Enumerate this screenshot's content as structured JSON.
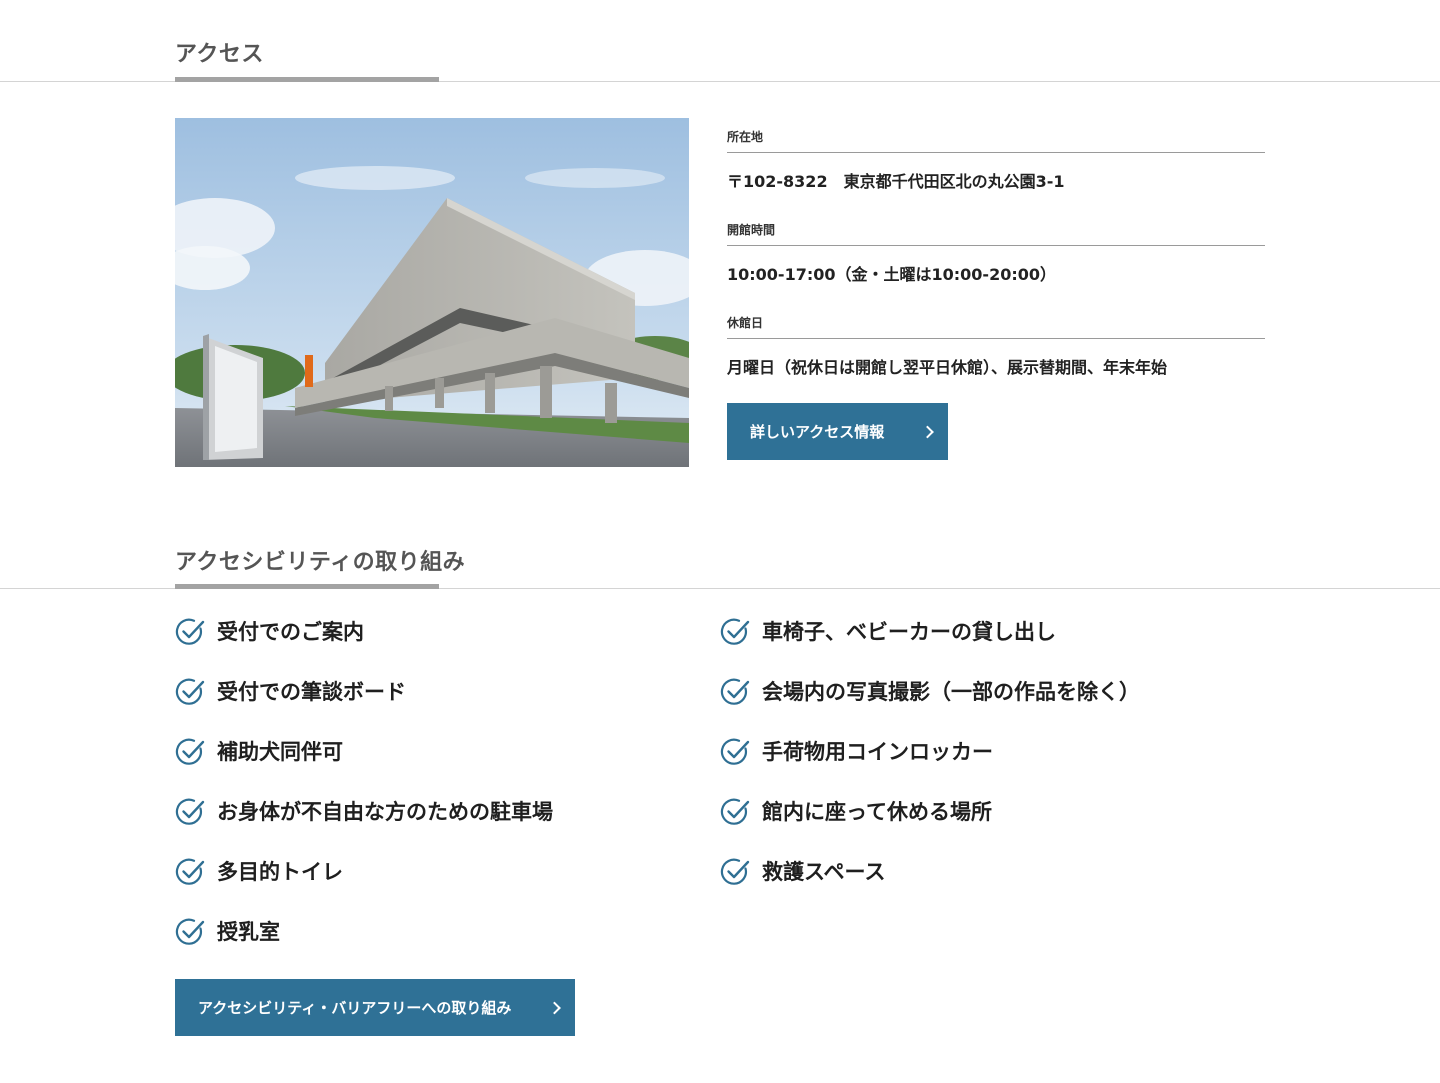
{
  "access": {
    "title": "アクセス",
    "photo": {
      "icon": "museum-building-photo"
    },
    "address_label": "所在地",
    "address_value": "〒102-8322　東京都千代田区北の丸公園3-1",
    "hours_label": "開館時間",
    "hours_value": "10:00-17:00（金・土曜は10:00-20:00）",
    "closed_label": "休館日",
    "closed_value": "月曜日（祝休日は開館し翌平日休館）、展示替期間、年末年始",
    "button_label": "詳しいアクセス情報"
  },
  "accessibility": {
    "title": "アクセシビリティの取り組み",
    "left_items": [
      "受付でのご案内",
      "受付での筆談ボード",
      "補助犬同伴可",
      "お身体が不自由な方のための駐車場",
      "多目的トイレ",
      "授乳室"
    ],
    "right_items": [
      "車椅子、ベビーカーの貸し出し",
      "会場内の写真撮影（一部の作品を除く）",
      "手荷物用コインロッカー",
      "館内に座って休める場所",
      "救護スペース"
    ],
    "button_label": "アクセシビリティ・バリアフリーへの取り組み"
  },
  "colors": {
    "button": "#2f7196",
    "check_icon": "#2f6f93",
    "underline": "#a3a3a3"
  }
}
